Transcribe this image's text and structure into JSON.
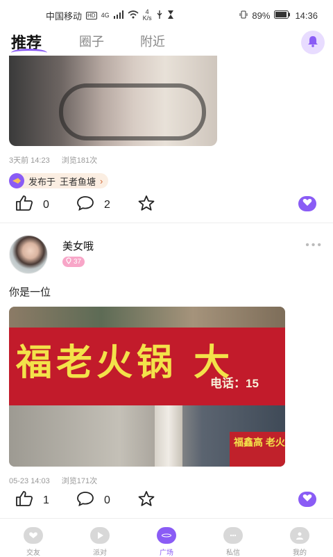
{
  "status": {
    "carrier": "中国移动",
    "hd": "HD",
    "net_type": "4G",
    "speed_value": "4",
    "speed_unit": "K/s",
    "battery": "89%",
    "time": "14:36"
  },
  "header": {
    "tabs": [
      {
        "label": "推荐",
        "active": true
      },
      {
        "label": "圈子",
        "active": false
      },
      {
        "label": "附近",
        "active": false
      }
    ]
  },
  "post1": {
    "time": "3天前 14:23",
    "views": "浏览181次",
    "published_prefix": "发布于",
    "circle_name": "王者鱼塘",
    "likes": "0",
    "comments": "2"
  },
  "post2": {
    "username": "美女哦",
    "level": "37",
    "text": "你是一位",
    "time": "05-23 14:03",
    "views": "浏览171次",
    "likes": "1",
    "comments": "0",
    "image_sign_text": "福老火锅 大",
    "image_sign_tel": "电话：15",
    "image_sign2": "福鑫高 老火"
  },
  "tabbar": {
    "items": [
      {
        "label": "交友",
        "icon": "chat-icon",
        "active": false
      },
      {
        "label": "派对",
        "icon": "play-icon",
        "active": false
      },
      {
        "label": "广场",
        "icon": "planet-icon",
        "active": true
      },
      {
        "label": "私信",
        "icon": "message-icon",
        "active": false
      },
      {
        "label": "我的",
        "icon": "avatar-icon",
        "active": false
      }
    ]
  },
  "colors": {
    "accent": "#8a5cf5",
    "level_badge": "#f8a6c8",
    "tag_bg": "#fbeee2"
  }
}
